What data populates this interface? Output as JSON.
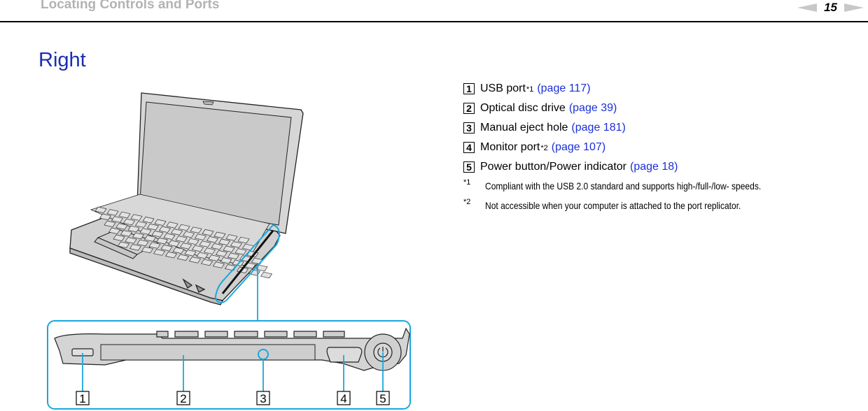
{
  "header": {
    "title": "Locating Controls and Ports",
    "page_number": "15",
    "prev_icon": "left-arrow-icon",
    "next_icon": "right-arrow-icon"
  },
  "section_title": "Right",
  "items": [
    {
      "num": "1",
      "label": "USB port",
      "footnote": "*1",
      "link": "(page 117)"
    },
    {
      "num": "2",
      "label": "Optical disc drive",
      "footnote": "",
      "link": "(page 39)"
    },
    {
      "num": "3",
      "label": "Manual eject hole",
      "footnote": "",
      "link": "(page 181)"
    },
    {
      "num": "4",
      "label": "Monitor port",
      "footnote": "*2",
      "link": "(page 107)"
    },
    {
      "num": "5",
      "label": "Power button/Power indicator",
      "footnote": "",
      "link": "(page 18)"
    }
  ],
  "notes": [
    {
      "mark": "*1",
      "text": "Compliant with the USB 2.0 standard and supports high-/full-/low- speeds."
    },
    {
      "mark": "*2",
      "text": "Not accessible when your computer is attached to the port replicator."
    }
  ],
  "figure": {
    "callouts": [
      "1",
      "2",
      "3",
      "4",
      "5"
    ],
    "highlight_color": "#1aa7dd"
  }
}
